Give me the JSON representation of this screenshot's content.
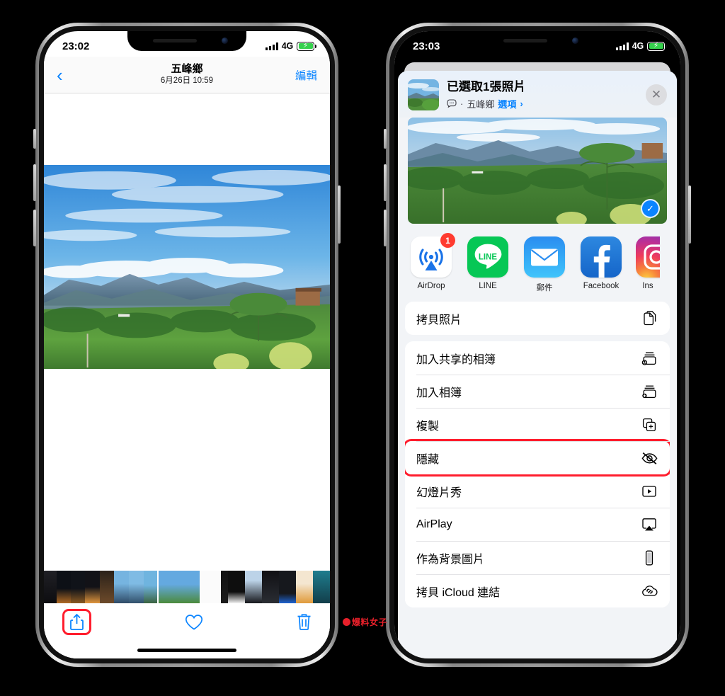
{
  "scene": {
    "watermark": "爆料女子",
    "accent_blue": "#0a84ff",
    "highlight_red": "#ff1d2d"
  },
  "left_phone": {
    "status_bar": {
      "time": "23:02",
      "network": "4G",
      "battery_state": "charging"
    },
    "nav": {
      "back_icon": "chevron-left-icon",
      "title": "五峰鄉",
      "subtitle": "6月26日  10:59",
      "edit_label": "編輯"
    },
    "toolbar": {
      "share_icon": "share-icon",
      "favorite_icon": "heart-icon",
      "delete_icon": "trash-icon"
    }
  },
  "right_phone": {
    "status_bar": {
      "time": "23:03",
      "network": "4G",
      "battery_state": "charging"
    },
    "share_sheet": {
      "title": "已選取1張照片",
      "subtitle_icon": "message-bubble-icon",
      "subtitle_sep": "·",
      "subtitle_place": "五峰鄉",
      "options_label": "選項",
      "options_chevron": "›",
      "close_icon": "close-icon",
      "selected_check_icon": "check-icon",
      "apps": [
        {
          "name": "AirDrop",
          "icon": "airdrop-icon",
          "badge": "1"
        },
        {
          "name": "LINE",
          "icon": "line-icon",
          "badge": ""
        },
        {
          "name": "郵件",
          "icon": "mail-icon",
          "badge": ""
        },
        {
          "name": "Facebook",
          "icon": "facebook-icon",
          "badge": ""
        },
        {
          "name": "Ins",
          "icon": "instagram-icon",
          "badge": ""
        }
      ],
      "groups": [
        {
          "rows": [
            {
              "label": "拷貝照片",
              "icon": "copy-photo-icon",
              "marked": false
            }
          ]
        },
        {
          "rows": [
            {
              "label": "加入共享的相簿",
              "icon": "shared-album-icon",
              "marked": false
            },
            {
              "label": "加入相簿",
              "icon": "add-album-icon",
              "marked": false
            },
            {
              "label": "複製",
              "icon": "duplicate-icon",
              "marked": false
            },
            {
              "label": "隱藏",
              "icon": "hide-eye-slash-icon",
              "marked": true
            },
            {
              "label": "幻燈片秀",
              "icon": "slideshow-icon",
              "marked": false
            },
            {
              "label": "AirPlay",
              "icon": "airplay-icon",
              "marked": false
            },
            {
              "label": "作為背景圖片",
              "icon": "wallpaper-icon",
              "marked": false
            },
            {
              "label": "拷貝 iCloud 連結",
              "icon": "icloud-link-icon",
              "marked": false
            }
          ]
        }
      ]
    }
  }
}
